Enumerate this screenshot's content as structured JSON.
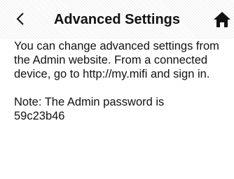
{
  "header": {
    "title": "Advanced Settings",
    "back_icon": "chevron-left-icon",
    "home_icon": "home-icon"
  },
  "content": {
    "info_line1": "You can change advanced settings from",
    "info_line2": "the Admin website. From a connected",
    "info_line3": "device, go to http://my.mifi and sign in.",
    "note_line1": "Note: The Admin password is",
    "note_line2": "59c23b46"
  },
  "colors": {
    "text": "#111111",
    "background": "#ffffff"
  }
}
